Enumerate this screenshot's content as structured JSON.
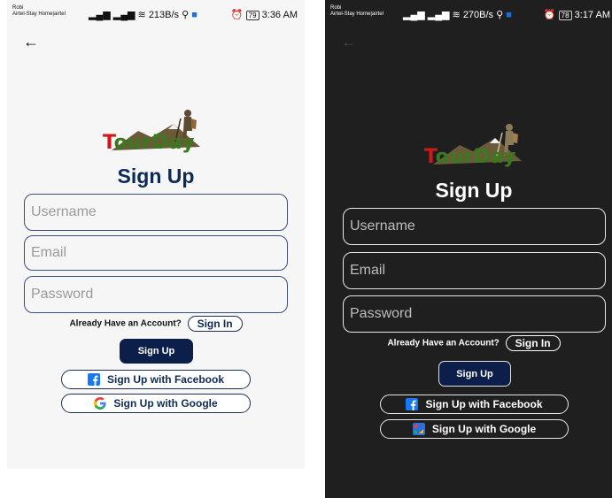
{
  "light": {
    "status": {
      "carrier_line1": "Robi",
      "carrier_line2": "Airtel-Stay Home|airtel",
      "speed": "213B/s",
      "battery": "79",
      "time": "3:36 AM"
    },
    "logo": {
      "red": "T",
      "green": "ourDay",
      "red2": ""
    },
    "title": "Sign Up",
    "fields": {
      "username_placeholder": "Username",
      "email_placeholder": "Email",
      "password_placeholder": "Password"
    },
    "already_text": "Already Have an Account?",
    "signin_label": "Sign In",
    "signup_label": "Sign Up",
    "facebook_label": "Sign Up with Facebook",
    "google_label": "Sign Up with Google"
  },
  "dark": {
    "status": {
      "carrier_line1": "Robi",
      "carrier_line2": "Airtel-Stay Home|airtel",
      "speed": "270B/s",
      "battery": "78",
      "time": "3:17 AM"
    },
    "logo": {
      "red": "T",
      "green": "ourDay",
      "red2": ""
    },
    "title": "Sign Up",
    "fields": {
      "username_placeholder": "Username",
      "email_placeholder": "Email",
      "password_placeholder": "Password"
    },
    "already_text": "Already Have an Account?",
    "signin_label": "Sign In",
    "signup_label": "Sign Up",
    "facebook_label": "Sign Up with Facebook",
    "google_label": "Sign Up with Google"
  },
  "colors": {
    "navy": "#0c1f4a",
    "facebook_blue": "#1877f2",
    "logo_green": "#3a7a1e",
    "logo_red": "#d01818"
  }
}
